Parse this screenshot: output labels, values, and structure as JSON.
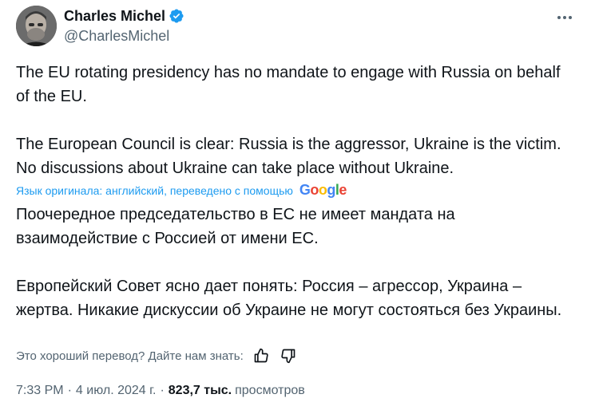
{
  "author": {
    "name": "Charles Michel",
    "handle": "@CharlesMichel"
  },
  "tweet": {
    "paragraphs": [
      "The EU rotating presidency has no mandate to engage with Russia on behalf of the EU.",
      "The European Council is clear: Russia is the aggressor, Ukraine is the victim. No discussions about Ukraine can take place without Ukraine."
    ]
  },
  "translation": {
    "notice": "Язык оригинала: английский, переведено с помощью",
    "provider": "Google",
    "paragraphs": [
      "Поочередное председательство в ЕС не имеет мандата на взаимодействие с Россией от имени ЕС.",
      "Европейский Совет ясно дает понять: Россия – агрессор, Украина – жертва. Никакие дискуссии об Украине не могут состояться без Украины."
    ],
    "feedback_prompt": "Это хороший перевод? Дайте нам знать:"
  },
  "meta": {
    "time": "7:33 PM",
    "separator": "·",
    "date": "4 июл. 2024 г.",
    "views_count": "823,7 тыс.",
    "views_label": "просмотров"
  },
  "colors": {
    "accent": "#1d9bf0",
    "text": "#0f1419",
    "secondary": "#536471"
  },
  "icons": {
    "verified": "verified-badge-icon",
    "more": "more-options-icon",
    "thumbs_up": "thumbs-up-icon",
    "thumbs_down": "thumbs-down-icon"
  }
}
